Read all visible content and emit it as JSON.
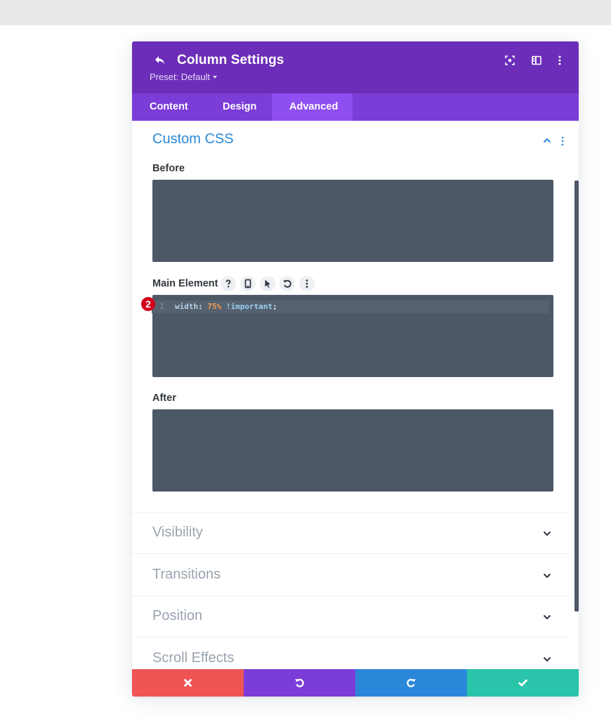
{
  "colors": {
    "header_bg": "#6c2eb9",
    "tabs_bg": "#7b3cd7",
    "tab_active_bg": "#8f4ef0",
    "accent_blue": "#2b87da",
    "code_bg": "#4c5866",
    "cancel": "#ef5555",
    "undo": "#7b3cd7",
    "redo": "#2b87da",
    "save": "#29c4a9",
    "badge": "#d0021b"
  },
  "header": {
    "title": "Column Settings",
    "preset": "Preset: Default",
    "icons": [
      "back-icon",
      "focus-icon",
      "split-view-icon",
      "more-options-icon"
    ]
  },
  "tabs": [
    {
      "label": "Content",
      "active": false
    },
    {
      "label": "Design",
      "active": false
    },
    {
      "label": "Advanced",
      "active": true
    }
  ],
  "custom_css": {
    "title": "Custom CSS",
    "before_label": "Before",
    "main_label": "Main Element",
    "after_label": "After",
    "main_controls": [
      "help-icon",
      "mobile-icon",
      "hover-cursor-icon",
      "reset-icon",
      "more-icon"
    ],
    "badge": "2",
    "code": {
      "line_number": "1",
      "property": "width",
      "colon": ":",
      "value": "75%",
      "important": "!important",
      "terminator": ";"
    }
  },
  "sections": [
    {
      "label": "Visibility"
    },
    {
      "label": "Transitions"
    },
    {
      "label": "Position"
    },
    {
      "label": "Scroll Effects"
    }
  ],
  "footer": [
    "cancel-icon",
    "undo-icon",
    "redo-icon",
    "save-icon"
  ]
}
